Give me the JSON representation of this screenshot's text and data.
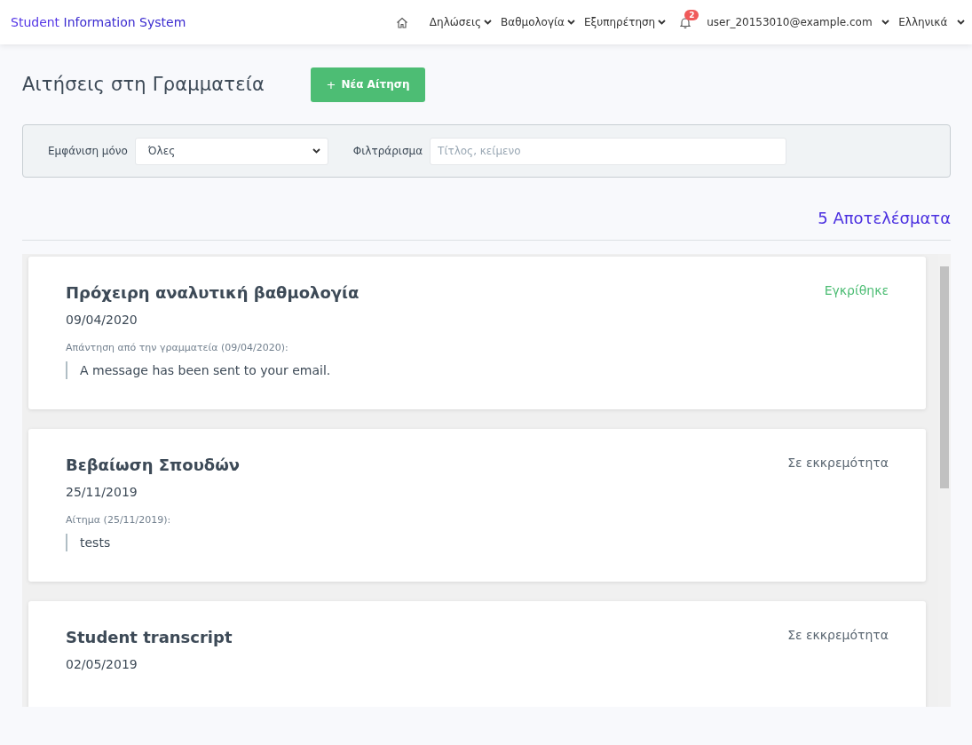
{
  "navbar": {
    "brand_first": "Student",
    "brand_rest": "Information System",
    "menus": [
      {
        "label": "Δηλώσεις"
      },
      {
        "label": "Βαθμολογία"
      },
      {
        "label": "Εξυπηρέτηση"
      }
    ],
    "notifications_count": "2",
    "user": "user_20153010@example.com",
    "language": "Ελληνικά"
  },
  "page": {
    "title": "Αιτήσεις στη Γραμματεία",
    "new_button": "Νέα Αίτηση",
    "new_button_icon": "+"
  },
  "filters": {
    "show_label": "Εμφάνιση μόνο",
    "show_value": "Όλες",
    "filter_label": "Φιλτράρισμα",
    "filter_placeholder": "Τίτλος, κείμενο"
  },
  "results_count": "5 Αποτελέσματα",
  "requests": [
    {
      "title": "Πρόχειρη αναλυτική βαθμολογία",
      "date": "09/04/2020",
      "status": "Εγκρίθηκε",
      "kind": "approved",
      "note_label": "Απάντηση από την γραμματεία (09/04/2020):",
      "note": "A message has been sent to your email."
    },
    {
      "title": "Βεβαίωση Σπουδών",
      "date": "25/11/2019",
      "status": "Σε εκκρεμότητα",
      "kind": "pending",
      "note_label": "Αίτημα (25/11/2019):",
      "note": "tests"
    },
    {
      "title": "Student transcript",
      "date": "02/05/2019",
      "status": "Σε εκκρεμότητα",
      "kind": "pending"
    }
  ]
}
